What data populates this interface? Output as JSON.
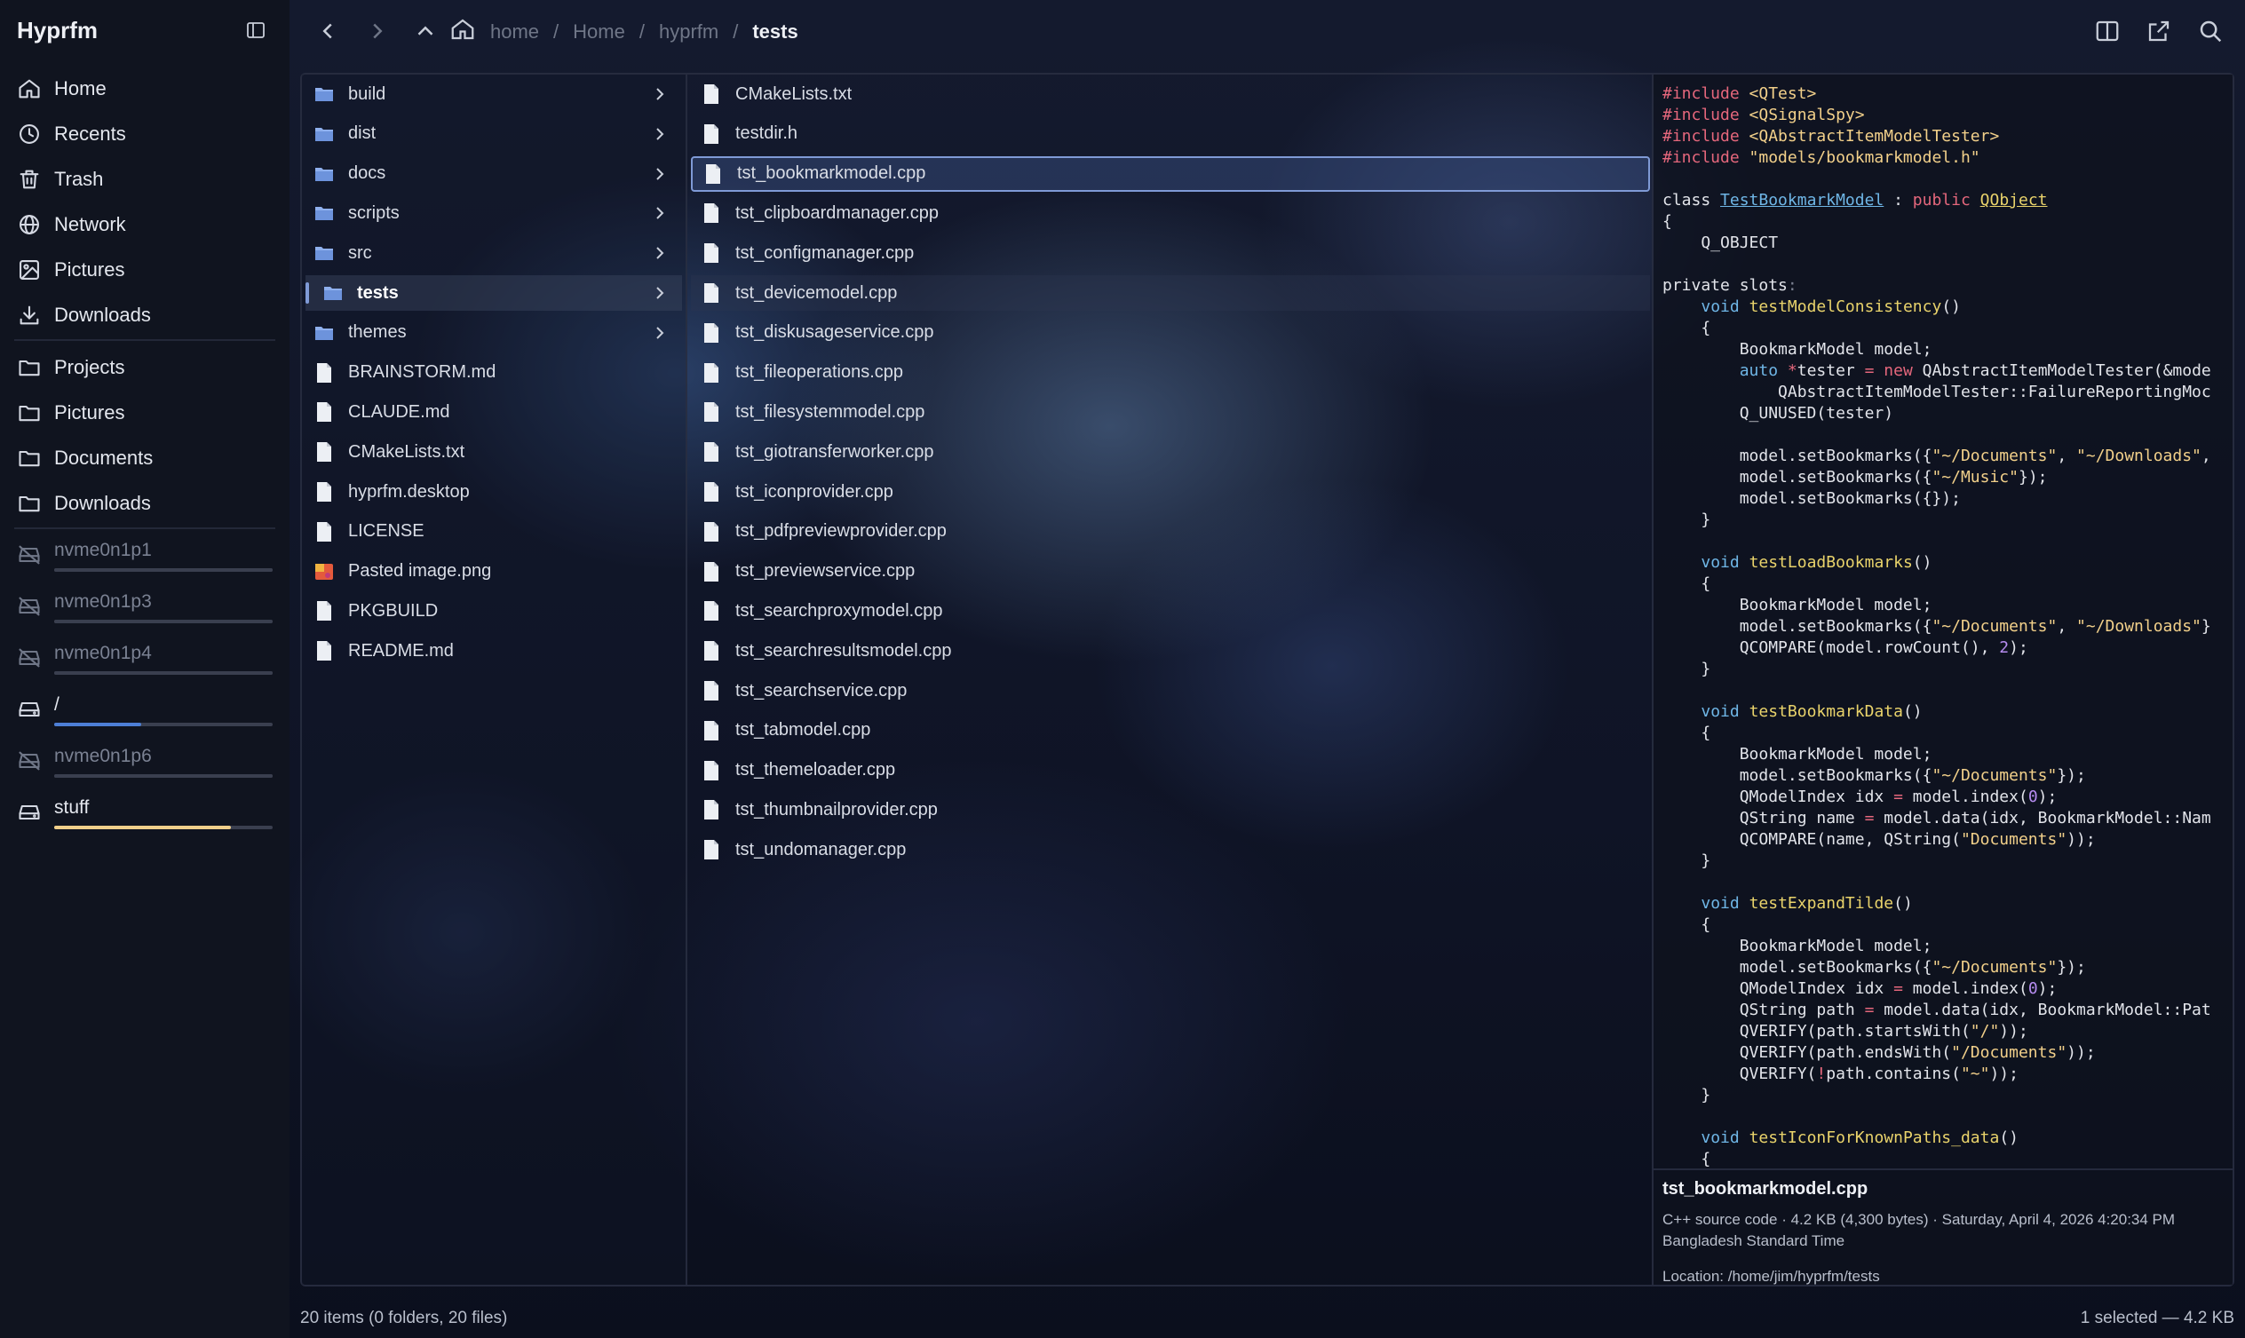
{
  "app": {
    "title": "Hyprfm"
  },
  "sidebar": {
    "places": [
      {
        "label": "Home",
        "icon": "home-icon"
      },
      {
        "label": "Recents",
        "icon": "clock-icon"
      },
      {
        "label": "Trash",
        "icon": "trash-icon"
      },
      {
        "label": "Network",
        "icon": "globe-icon"
      },
      {
        "label": "Pictures",
        "icon": "image-icon"
      },
      {
        "label": "Downloads",
        "icon": "download-icon"
      }
    ],
    "bookmarks": [
      {
        "label": "Projects",
        "icon": "folder-icon"
      },
      {
        "label": "Pictures",
        "icon": "folder-icon"
      },
      {
        "label": "Documents",
        "icon": "folder-icon"
      },
      {
        "label": "Downloads",
        "icon": "folder-icon"
      }
    ],
    "drives": [
      {
        "label": "nvme0n1p1",
        "mounted": false,
        "usage": 1.0,
        "bar_color": "#3a3f4f"
      },
      {
        "label": "nvme0n1p3",
        "mounted": false,
        "usage": 1.0,
        "bar_color": "#3a3f4f"
      },
      {
        "label": "nvme0n1p4",
        "mounted": false,
        "usage": 1.0,
        "bar_color": "#3a3f4f"
      },
      {
        "label": "/",
        "mounted": true,
        "usage": 0.4,
        "bar_color": "#4d7fd6"
      },
      {
        "label": "nvme0n1p6",
        "mounted": false,
        "usage": 1.0,
        "bar_color": "#3a3f4f"
      },
      {
        "label": "stuff",
        "mounted": true,
        "usage": 0.81,
        "bar_color": "#f0cf8a"
      }
    ]
  },
  "breadcrumb": {
    "items": [
      "home",
      "Home",
      "hyprfm"
    ],
    "current": "tests",
    "separator": "/"
  },
  "column1": {
    "folders": [
      "build",
      "dist",
      "docs",
      "scripts",
      "src",
      "tests",
      "themes"
    ],
    "active_folder": "tests",
    "files": [
      "BRAINSTORM.md",
      "CLAUDE.md",
      "CMakeLists.txt",
      "hyprfm.desktop",
      "LICENSE",
      "Pasted image.png",
      "PKGBUILD",
      "README.md"
    ]
  },
  "column2": {
    "files": [
      "CMakeLists.txt",
      "testdir.h",
      "tst_bookmarkmodel.cpp",
      "tst_clipboardmanager.cpp",
      "tst_configmanager.cpp",
      "tst_devicemodel.cpp",
      "tst_diskusageservice.cpp",
      "tst_fileoperations.cpp",
      "tst_filesystemmodel.cpp",
      "tst_giotransferworker.cpp",
      "tst_iconprovider.cpp",
      "tst_pdfpreviewprovider.cpp",
      "tst_previewservice.cpp",
      "tst_searchproxymodel.cpp",
      "tst_searchresultsmodel.cpp",
      "tst_searchservice.cpp",
      "tst_tabmodel.cpp",
      "tst_themeloader.cpp",
      "tst_thumbnailprovider.cpp",
      "tst_undomanager.cpp"
    ],
    "selected": "tst_bookmarkmodel.cpp",
    "hovered": "tst_devicemodel.cpp"
  },
  "preview": {
    "code_lines": [
      "#include <QTest>",
      "#include <QSignalSpy>",
      "#include <QAbstractItemModelTester>",
      "#include \"models/bookmarkmodel.h\"",
      "",
      "class TestBookmarkModel : public QObject",
      "{",
      "    Q_OBJECT",
      "",
      "private slots:",
      "    void testModelConsistency()",
      "    {",
      "        BookmarkModel model;",
      "        auto *tester = new QAbstractItemModelTester(&mode",
      "            QAbstractItemModelTester::FailureReportingMoc",
      "        Q_UNUSED(tester)",
      "",
      "        model.setBookmarks({\"~/Documents\", \"~/Downloads\",",
      "        model.setBookmarks({\"~/Music\"});",
      "        model.setBookmarks({});",
      "    }",
      "",
      "    void testLoadBookmarks()",
      "    {",
      "        BookmarkModel model;",
      "        model.setBookmarks({\"~/Documents\", \"~/Downloads\"}",
      "        QCOMPARE(model.rowCount(), 2);",
      "    }",
      "",
      "    void testBookmarkData()",
      "    {",
      "        BookmarkModel model;",
      "        model.setBookmarks({\"~/Documents\"});",
      "        QModelIndex idx = model.index(0);",
      "        QString name = model.data(idx, BookmarkModel::Nam",
      "        QCOMPARE(name, QString(\"Documents\"));",
      "    }",
      "",
      "    void testExpandTilde()",
      "    {",
      "        BookmarkModel model;",
      "        model.setBookmarks({\"~/Documents\"});",
      "        QModelIndex idx = model.index(0);",
      "        QString path = model.data(idx, BookmarkModel::Pat",
      "        QVERIFY(path.startsWith(\"/\"));",
      "        QVERIFY(path.endsWith(\"/Documents\"));",
      "        QVERIFY(!path.contains(\"~\"));",
      "    }",
      "",
      "    void testIconForKnownPaths_data()",
      "    {"
    ],
    "file_name": "tst_bookmarkmodel.cpp",
    "meta": "C++ source code · 4.2 KB (4,300 bytes) · Saturday, April 4, 2026 4:20:34 PM Bangladesh Standard Time",
    "location": "Location: /home/jim/hyprfm/tests"
  },
  "status": {
    "left": "20 items (0 folders, 20 files)",
    "right": "1 selected — 4.2 KB"
  },
  "colors": {
    "accent": "#7f9ad6",
    "folder": "#8fb0ee",
    "background": "#0d1120"
  }
}
